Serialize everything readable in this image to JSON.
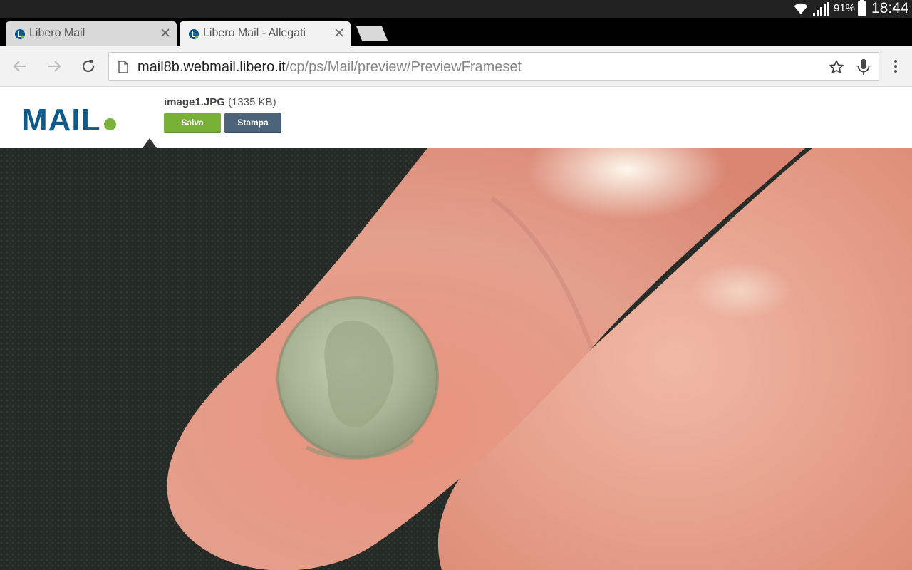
{
  "status_bar": {
    "battery": "91%",
    "time": "18:44",
    "icons": [
      "wifi-icon",
      "signal-icon",
      "battery-icon"
    ]
  },
  "tabs": [
    {
      "title": "Libero Mail",
      "active": false
    },
    {
      "title": "Libero Mail - Allegati",
      "active": true
    }
  ],
  "toolbar": {
    "url_host": "mail8b.webmail.libero.it",
    "url_path": "/cp/ps/Mail/preview/PreviewFrameset"
  },
  "mail": {
    "logo_text": "MAIL",
    "attachment_name": "image1.JPG",
    "attachment_size": "(1335 KB)",
    "save_label": "Salva",
    "print_label": "Stampa"
  },
  "colors": {
    "logo_blue": "#0d5a8c",
    "logo_green": "#7ab33c",
    "save_button": "#79b036",
    "print_button": "#4b647a"
  }
}
